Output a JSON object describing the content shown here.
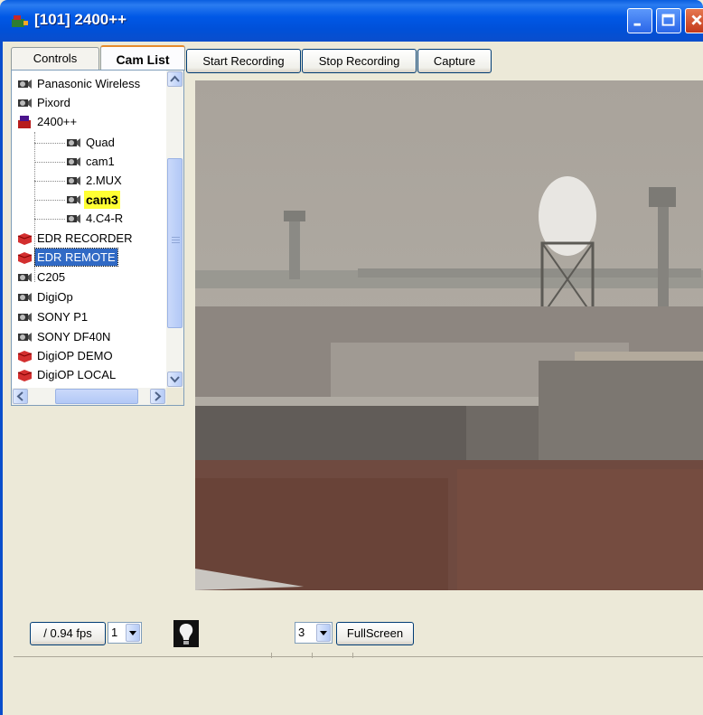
{
  "window": {
    "title": "[101] 2400++"
  },
  "tabs": [
    {
      "label": "Controls",
      "active": false
    },
    {
      "label": "Cam List",
      "active": true
    }
  ],
  "toolbar": {
    "start_label": "Start Recording",
    "stop_label": "Stop Recording",
    "capture_label": "Capture"
  },
  "tree": {
    "items": [
      {
        "label": "Panasonic Wireless",
        "icon": "camera-icon",
        "level": 0
      },
      {
        "label": "Pixord",
        "icon": "camera-icon",
        "level": 0
      },
      {
        "label": "2400++",
        "icon": "video-server-icon",
        "level": 0
      },
      {
        "label": "Quad",
        "icon": "camera-icon",
        "level": 1
      },
      {
        "label": "cam1",
        "icon": "camera-icon",
        "level": 1
      },
      {
        "label": "2.MUX",
        "icon": "camera-icon",
        "level": 1
      },
      {
        "label": "cam3",
        "icon": "camera-icon",
        "level": 1,
        "highlighted": true
      },
      {
        "label": "4.C4-R",
        "icon": "camera-icon",
        "level": 1
      },
      {
        "label": "EDR RECORDER",
        "icon": "recorder-icon",
        "level": 0
      },
      {
        "label": "EDR REMOTE",
        "icon": "recorder-icon",
        "level": 0,
        "selected": true
      },
      {
        "label": "C205",
        "icon": "camera-icon",
        "level": 0
      },
      {
        "label": "DigiOp",
        "icon": "camera-icon",
        "level": 0
      },
      {
        "label": "SONY P1",
        "icon": "camera-icon",
        "level": 0
      },
      {
        "label": "SONY DF40N",
        "icon": "camera-icon",
        "level": 0
      },
      {
        "label": "DigiOP DEMO",
        "icon": "recorder-icon",
        "level": 0
      },
      {
        "label": "DigiOP LOCAL",
        "icon": "recorder-icon",
        "level": 0
      }
    ]
  },
  "bottom": {
    "fps_label": "/ 0.94 fps",
    "fps_select": "1",
    "layout_select": "3",
    "fullscreen_label": "FullScreen"
  },
  "colors": {
    "titlebar": "#0058e6",
    "selection": "#316ac5",
    "highlight": "#ffff33"
  }
}
